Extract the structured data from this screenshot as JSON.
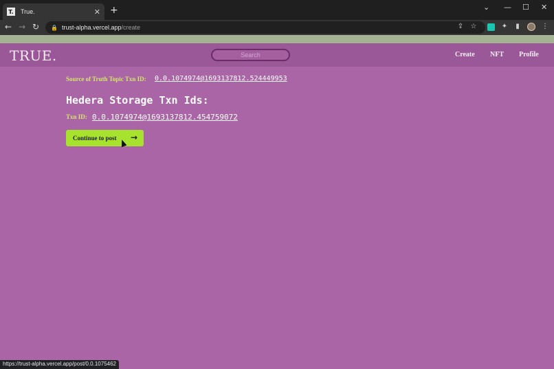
{
  "browser": {
    "tab_title": "True.",
    "tab_favicon": "T.",
    "url_host": "trust-alpha.vercel.app",
    "url_path": "/create",
    "status_url": "https://trust-alpha.vercel.app/post/0.0.1075462"
  },
  "header": {
    "logo": "TRUE.",
    "search_placeholder": "Search",
    "nav": [
      "Create",
      "NFT",
      "Profile"
    ]
  },
  "content": {
    "topic_label": "Source of Truth Topic Txn ID:",
    "topic_txn_id": "0.0.1074974@1693137812.524449953",
    "heading": "Hedera Storage Txn Ids:",
    "txn_label": "Txn ID:",
    "txn_id": "0.0.1074974@1693137812.454759072",
    "continue_label": "Continue to post"
  },
  "colors": {
    "page_bg": "#a965a5",
    "header_bg": "#9a5898",
    "accent_label": "#d6e66a",
    "button_bg": "#a6e22e"
  }
}
